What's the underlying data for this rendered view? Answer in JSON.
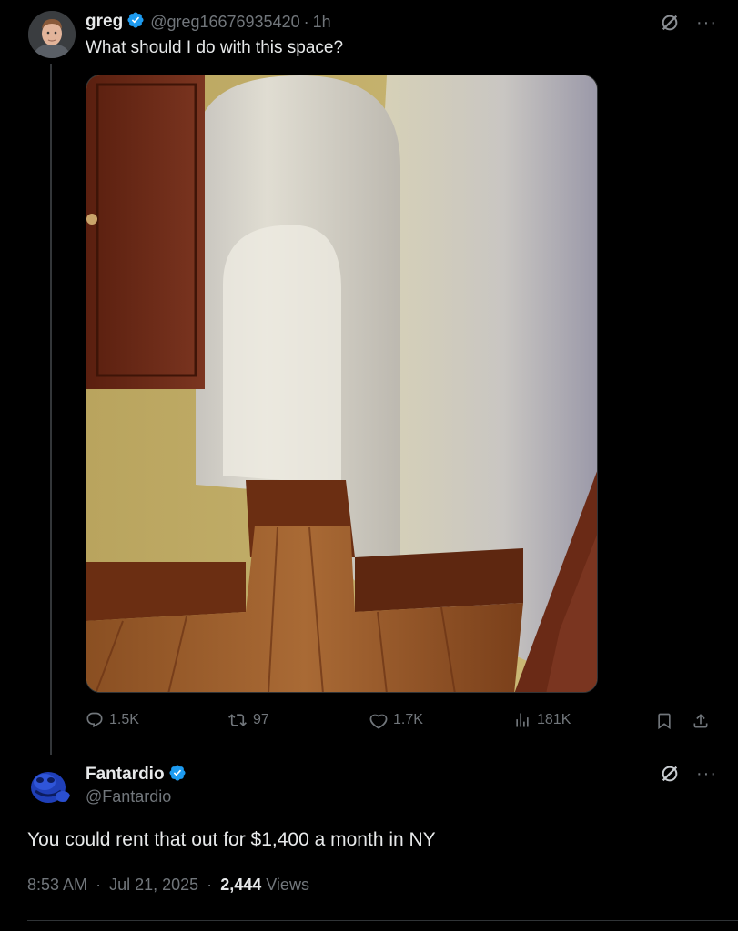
{
  "post": {
    "name": "greg",
    "handle": "@greg16676935420",
    "time": "1h",
    "text": "What should I do with this space?",
    "stats": {
      "replies": "1.5K",
      "reposts": "97",
      "likes": "1.7K",
      "views": "181K"
    }
  },
  "reply": {
    "name": "Fantardio",
    "handle": "@Fantardio",
    "text": "You could rent that out for $1,400 a month in NY",
    "time": "8:53 AM",
    "date": "Jul 21, 2025",
    "views_count": "2,444",
    "views_label": "Views"
  },
  "icons": {
    "verified": "verified-badge-icon",
    "grok": "grok-icon",
    "more": "more-icon",
    "reply": "reply-icon",
    "repost": "repost-icon",
    "like": "like-icon",
    "views": "views-icon",
    "bookmark": "bookmark-icon",
    "share": "share-icon"
  },
  "colors": {
    "background": "#000000",
    "text": "#e7e9ea",
    "secondary": "#71767b",
    "verified": "#1d9bf0"
  }
}
